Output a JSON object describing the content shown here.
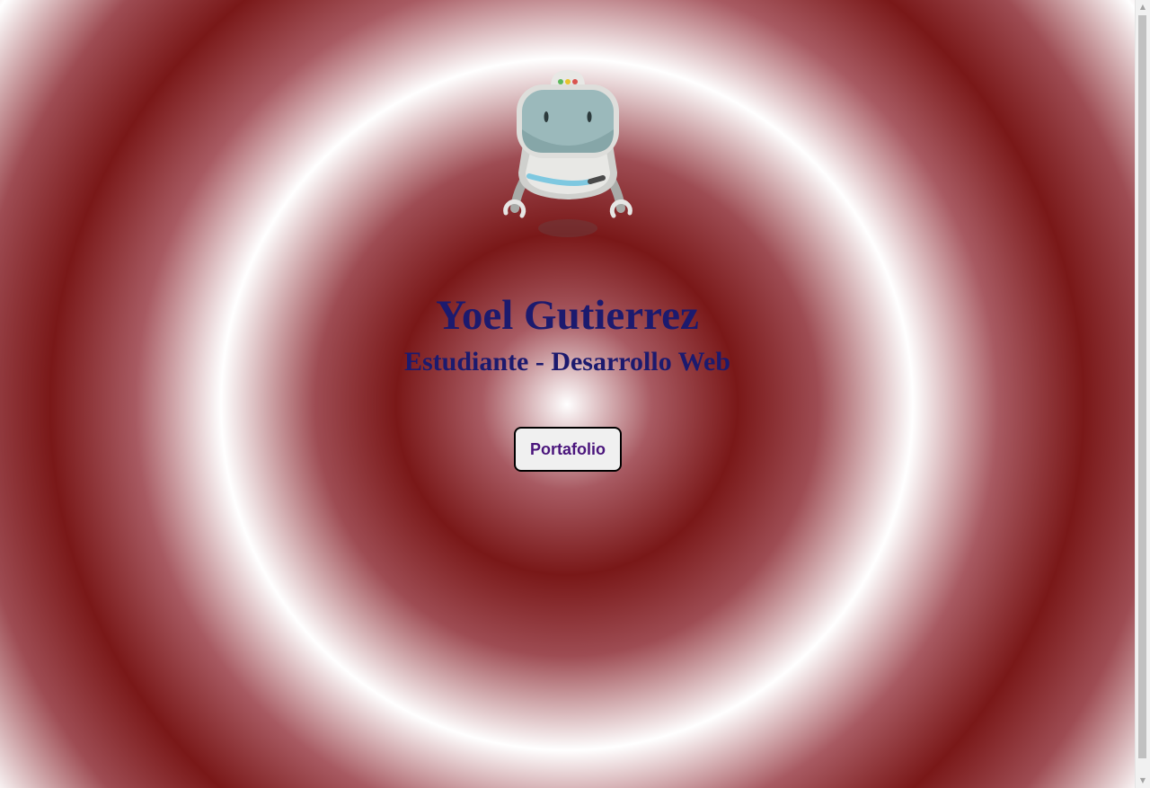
{
  "profile": {
    "name": "Yoel Gutierrez",
    "subtitle": "Estudiante - Desarrollo Web",
    "portfolio_button": "Portafolio",
    "avatar_icon": "robot-astronaut-icon"
  },
  "colors": {
    "heading": "#1c1a6e",
    "button_text": "#4a157c",
    "ring_dark": "#7a1818",
    "ring_light": "#ffffff"
  },
  "scrollbar": {
    "up_icon": "scroll-up-arrow-icon",
    "down_icon": "scroll-down-arrow-icon"
  }
}
